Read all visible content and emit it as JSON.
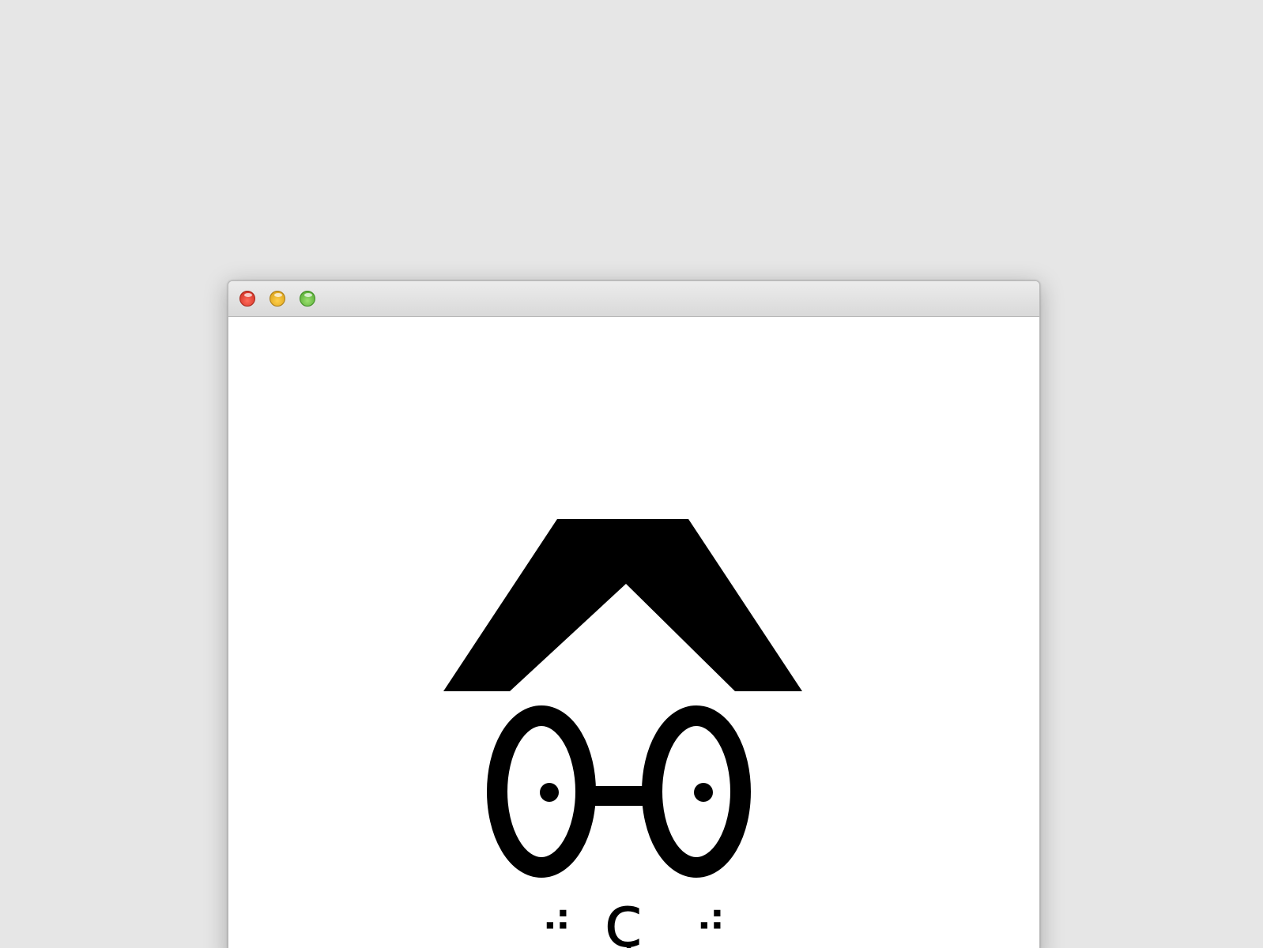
{
  "window": {
    "controls": {
      "close_icon": "close-icon",
      "minimize_icon": "minimize-icon",
      "maximize_icon": "maximize-icon",
      "close_color": "#ff5f57",
      "minimize_color": "#ffbd2e",
      "maximize_color": "#28c840"
    }
  },
  "face": {
    "nose": "ç",
    "left_cheek": "⠴",
    "right_cheek": "⠴",
    "ink_color": "#000000",
    "background_color": "#ffffff"
  }
}
